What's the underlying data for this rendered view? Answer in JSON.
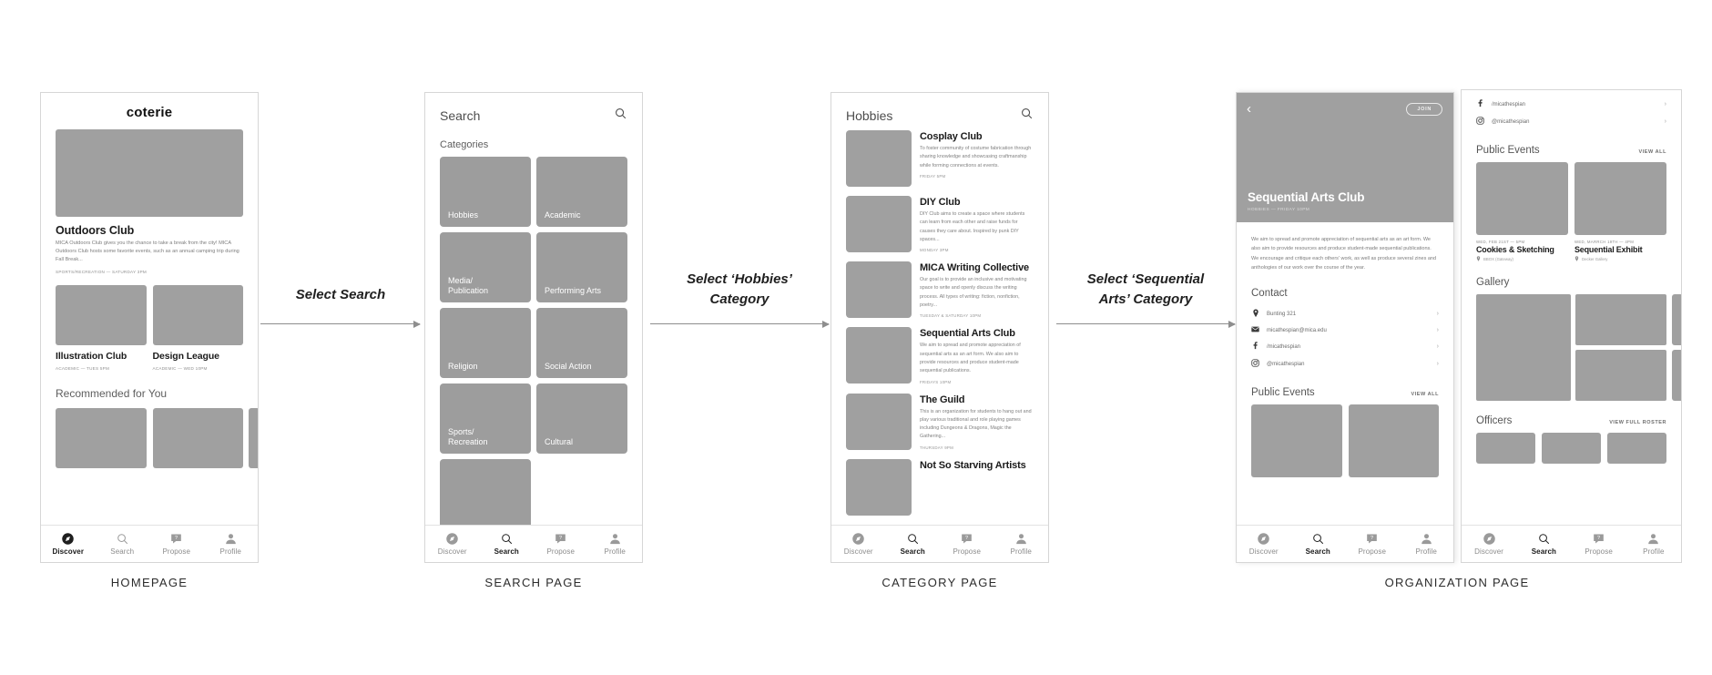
{
  "app": {
    "brand": "coterie"
  },
  "tabbar": {
    "items": [
      {
        "id": "discover",
        "label": "Discover",
        "icon": "compass-icon"
      },
      {
        "id": "search",
        "label": "Search",
        "icon": "search-icon"
      },
      {
        "id": "propose",
        "label": "Propose",
        "icon": "propose-icon"
      },
      {
        "id": "profile",
        "label": "Profile",
        "icon": "person-icon"
      }
    ]
  },
  "homepage": {
    "caption": "HOMEPAGE",
    "active_tab": "Discover",
    "featured": {
      "title": "Outdoors Club",
      "body": "MICA Outdoors Club gives you the chance to take a break from the city! MICA Outdoors Club hosts some favorite events, such as an annual camping trip during Fall Break...",
      "meta": "SPORTS/RECREATION — SATURDAY 3PM"
    },
    "cards": [
      {
        "title": "Illustration Club",
        "meta": "ACADEMIC — TUES 5PM"
      },
      {
        "title": "Design League",
        "meta": "ACADEMIC — WED 10PM"
      }
    ],
    "recommended_heading": "Recommended for You"
  },
  "search_page": {
    "caption": "SEARCH PAGE",
    "active_tab": "Search",
    "title": "Search",
    "search_icon": "search-icon",
    "categories_label": "Categories",
    "categories": [
      "Hobbies",
      "Academic",
      "Media/\nPublication",
      "Performing Arts",
      "Religion",
      "Social Action",
      "Sports/\nRecreation",
      "Cultural"
    ]
  },
  "category_page": {
    "caption": "CATEGORY PAGE",
    "active_tab": "Search",
    "title": "Hobbies",
    "search_icon": "search-icon",
    "clubs": [
      {
        "name": "Cosplay Club",
        "desc": "To foster community of costume fabrication through sharing knowledge and showcasing craftmanship while forming connections at events.",
        "meta": "FRIDAY 5PM"
      },
      {
        "name": "DIY Club",
        "desc": "DIY Club aims to create a space where students can learn from each other and raise funds for causes they care about. Inspired by punk DIY spaces...",
        "meta": "MONDAY 3PM"
      },
      {
        "name": "MICA Writing Collective",
        "desc": "Our goal is to provide an inclusive and motivating space to write and openly discuss the writing process. All types of writing: fiction, nonfiction, poetry...",
        "meta": "TUESDAY & SATURDAY 10PM"
      },
      {
        "name": "Sequential Arts Club",
        "desc": "We aim to spread and promote appreciation of sequential arts as an art form. We also aim to provide resources and produce student-made sequential publications.",
        "meta": "FRIDAYS 10PM"
      },
      {
        "name": "The Guild",
        "desc": "This is an organization for students to hang out and play various traditional and role playing games including Dungeons & Dragons, Magic the Gathering...",
        "meta": "THURSDAY 9PM"
      },
      {
        "name": "Not So Starving Artists",
        "desc": "",
        "meta": ""
      }
    ]
  },
  "organization_page": {
    "caption": "ORGANIZATION PAGE",
    "active_tab": "Search",
    "back_icon": "chevron-left-icon",
    "join_label": "JOIN",
    "title": "Sequential Arts Club",
    "subtitle": "HOBBIES — FRIDAY 10PM",
    "description": "We aim to spread and promote appreciation of sequential arts as an art form. We also aim to provide resources and produce student-made sequential publications. We encourage and critique each others' work, as well as produce several zines and anthologies of our work over the course of the year.",
    "contact_heading": "Contact",
    "contacts": [
      {
        "icon": "location-pin-icon",
        "text": "Bunting 321",
        "chevron": "›"
      },
      {
        "icon": "mail-icon",
        "text": "micathespian@mica.edu",
        "chevron": "›"
      },
      {
        "icon": "facebook-icon",
        "text": "/micathespian",
        "chevron": "›"
      },
      {
        "icon": "instagram-icon",
        "text": "@micathespian",
        "chevron": "›"
      }
    ],
    "public_events_heading": "Public Events",
    "view_all_label": "VIEW ALL",
    "events": [
      {
        "date": "WED, FEB 21ST — 5PM",
        "name": "Cookies & Sketching",
        "location": "BBOX (Gateway)"
      },
      {
        "date": "WED, MARRCH 19TH — 4PM",
        "name": "Sequential Exhibit",
        "location": "Decker Gallery"
      }
    ],
    "gallery_heading": "Gallery",
    "officers_heading": "Officers",
    "view_roster_label": "VIEW FULL ROSTER"
  },
  "flows": [
    {
      "id": "flow-1",
      "text": "Select Search"
    },
    {
      "id": "flow-2",
      "line1": "Select ‘Hobbies’",
      "line2": "Category"
    },
    {
      "id": "flow-3",
      "line1": "Select ‘Sequential",
      "line2": "Arts’ Category"
    }
  ]
}
